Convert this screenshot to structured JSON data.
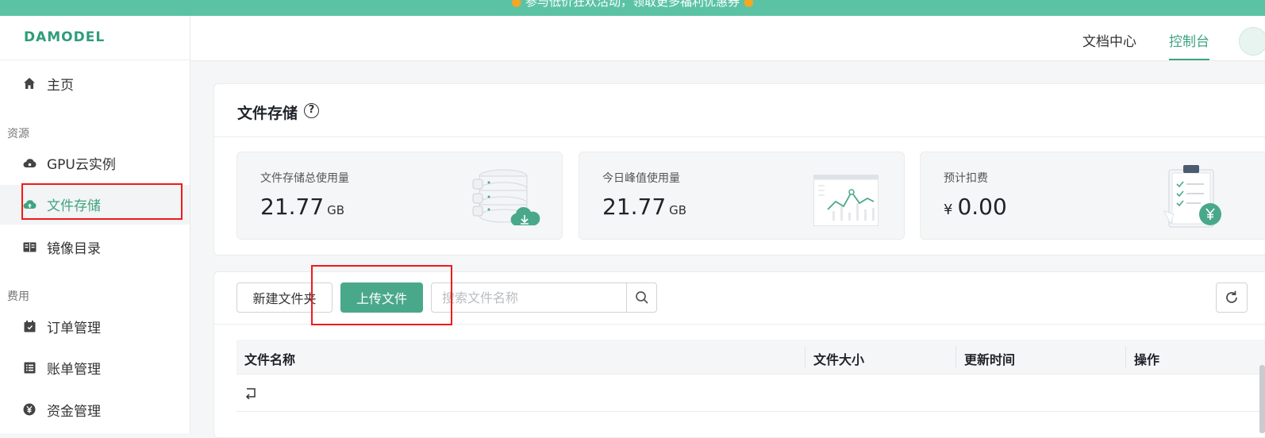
{
  "banner": {
    "text": "参与低价狂欢活动，领取更多福利优惠券"
  },
  "brand": {
    "logo": "DAMODEL",
    "accent_color": "#3da57f"
  },
  "sidebar": {
    "home": {
      "label": "主页",
      "icon": "home-icon"
    },
    "section_resources": "资源",
    "gpu": {
      "label": "GPU云实例",
      "icon": "cloud-icon"
    },
    "storage": {
      "label": "文件存储",
      "icon": "cloud-upload-icon",
      "active": true
    },
    "images": {
      "label": "镜像目录",
      "icon": "book-icon"
    },
    "section_billing": "费用",
    "orders": {
      "label": "订单管理",
      "icon": "calendar-icon"
    },
    "bills": {
      "label": "账单管理",
      "icon": "list-icon"
    },
    "funds": {
      "label": "资金管理",
      "icon": "yen-icon"
    }
  },
  "topnav": {
    "docs": "文档中心",
    "console": "控制台"
  },
  "storage": {
    "title": "文件存储",
    "stats": [
      {
        "label": "文件存储总使用量",
        "value": "21.77",
        "unit": "GB"
      },
      {
        "label": "今日峰值使用量",
        "value": "21.77",
        "unit": "GB"
      },
      {
        "label": "预计扣费",
        "prefix": "¥",
        "value": "0.00"
      }
    ]
  },
  "toolbar": {
    "new_folder": "新建文件夹",
    "upload": "上传文件",
    "search_placeholder": "搜索文件名称"
  },
  "table": {
    "columns": [
      "文件名称",
      "文件大小",
      "更新时间",
      "操作"
    ]
  }
}
